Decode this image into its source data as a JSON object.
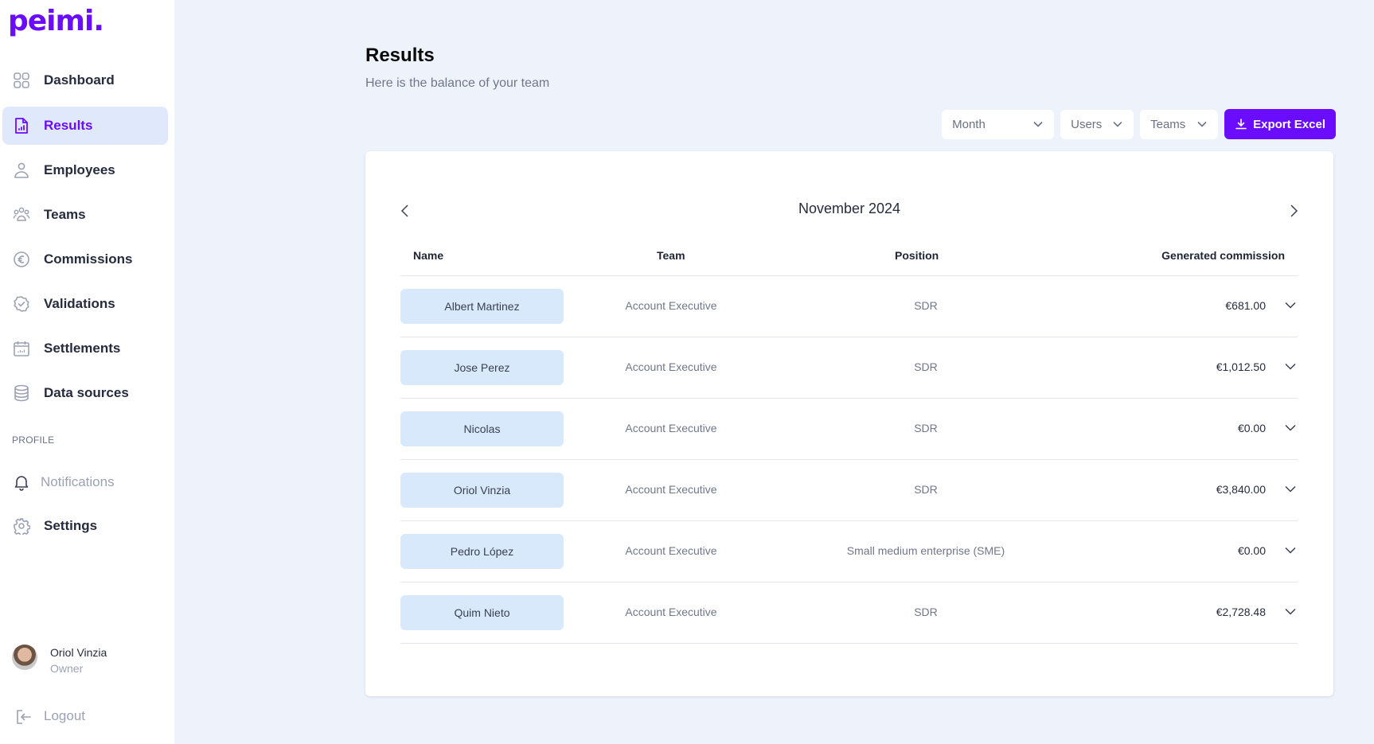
{
  "brand": {
    "logo": "peimi.",
    "accent": "#6a0dff"
  },
  "sidebar": {
    "items": [
      {
        "label": "Dashboard",
        "icon": "grid-icon",
        "active": false
      },
      {
        "label": "Results",
        "icon": "document-chart-icon",
        "active": true
      },
      {
        "label": "Employees",
        "icon": "user-icon",
        "active": false
      },
      {
        "label": "Teams",
        "icon": "users-group-icon",
        "active": false
      },
      {
        "label": "Commissions",
        "icon": "euro-icon",
        "active": false
      },
      {
        "label": "Validations",
        "icon": "check-badge-icon",
        "active": false
      },
      {
        "label": "Settlements",
        "icon": "calendar-icon",
        "active": false
      },
      {
        "label": "Data sources",
        "icon": "database-icon",
        "active": false
      }
    ],
    "profile_section_label": "PROFILE",
    "profile_items": [
      {
        "label": "Notifications",
        "icon": "bell-icon",
        "muted": true
      },
      {
        "label": "Settings",
        "icon": "gear-icon",
        "muted": false
      }
    ],
    "user": {
      "name": "Oriol Vinzia",
      "role": "Owner"
    },
    "logout_label": "Logout"
  },
  "header": {
    "title": "Results",
    "subtitle": "Here is the balance of your team"
  },
  "filters": {
    "month": "Month",
    "users": "Users",
    "teams": "Teams",
    "export_label": "Export Excel"
  },
  "results": {
    "period_label": "November 2024",
    "columns": {
      "name": "Name",
      "team": "Team",
      "position": "Position",
      "commission": "Generated commission"
    },
    "rows": [
      {
        "name": "Albert Martinez",
        "team": "Account Executive",
        "position": "SDR",
        "commission": "€681.00"
      },
      {
        "name": "Jose Perez",
        "team": "Account Executive",
        "position": "SDR",
        "commission": "€1,012.50"
      },
      {
        "name": "Nicolas",
        "team": "Account Executive",
        "position": "SDR",
        "commission": "€0.00"
      },
      {
        "name": "Oriol Vinzia",
        "team": "Account Executive",
        "position": "SDR",
        "commission": "€3,840.00"
      },
      {
        "name": "Pedro López",
        "team": "Account Executive",
        "position": "Small medium enterprise (SME)",
        "commission": "€0.00"
      },
      {
        "name": "Quim Nieto",
        "team": "Account Executive",
        "position": "SDR",
        "commission": "€2,728.48"
      }
    ]
  }
}
